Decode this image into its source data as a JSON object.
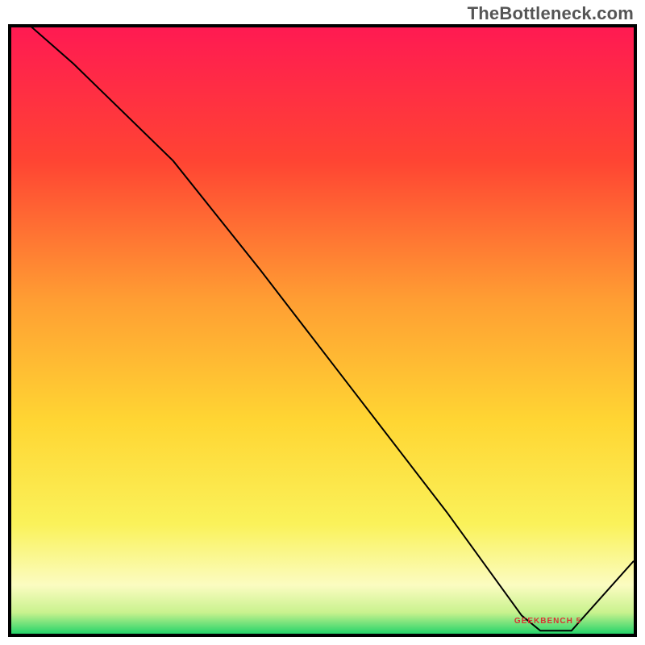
{
  "watermark": "TheBottleneck.com",
  "optimum_label": "GEEKBENCH 5",
  "chart_data": {
    "type": "line",
    "title": "",
    "xlabel": "",
    "ylabel": "",
    "xlim": [
      0,
      100
    ],
    "ylim": [
      0,
      100
    ],
    "x": [
      0,
      10,
      26,
      40,
      55,
      70,
      82,
      85,
      90,
      100
    ],
    "values": [
      103,
      94,
      78,
      60,
      40,
      20,
      3,
      0.5,
      0.5,
      12
    ],
    "optimum_range_x": [
      82,
      90
    ],
    "gradient": {
      "stops": [
        {
          "offset": 0.0,
          "color": "#ff1a52"
        },
        {
          "offset": 0.22,
          "color": "#ff4433"
        },
        {
          "offset": 0.45,
          "color": "#ff9e33"
        },
        {
          "offset": 0.65,
          "color": "#ffd633"
        },
        {
          "offset": 0.82,
          "color": "#faf25a"
        },
        {
          "offset": 0.92,
          "color": "#fbfcc1"
        },
        {
          "offset": 0.965,
          "color": "#c9f28e"
        },
        {
          "offset": 1.0,
          "color": "#26d46a"
        }
      ]
    },
    "annotations": [
      {
        "text": "GEEKBENCH 5",
        "x": 86,
        "y": 2
      }
    ]
  }
}
